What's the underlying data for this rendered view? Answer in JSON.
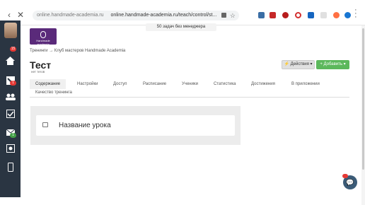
{
  "browser": {
    "url_host": "online.handmade-academia.ru",
    "url_path": "online.handmade-academia.ru/teach/control/st..."
  },
  "tooltip": "50 задач без менеджера",
  "sidebar": {
    "badges": [
      "15",
      "1",
      "1"
    ]
  },
  "logo": {
    "text": "Handmade academia"
  },
  "breadcrumb": "Тренинги → Клуб мастеров Handmade Academia",
  "page": {
    "title": "Тест",
    "subtitle": "нет тегов"
  },
  "buttons": {
    "actions": "⚡ Действия ▾",
    "add": "+ Добавить ▾"
  },
  "tabs": [
    "Содержание",
    "Настройки",
    "Доступ",
    "Расписание",
    "Ученики",
    "Статистика",
    "Достижения",
    "В приложении",
    "Качество тренинга"
  ],
  "lesson": {
    "title": "Название урока"
  },
  "colors": {
    "sidebar": "#2a3542",
    "accent_green": "#5cb85c",
    "badge_red": "#e53935"
  }
}
